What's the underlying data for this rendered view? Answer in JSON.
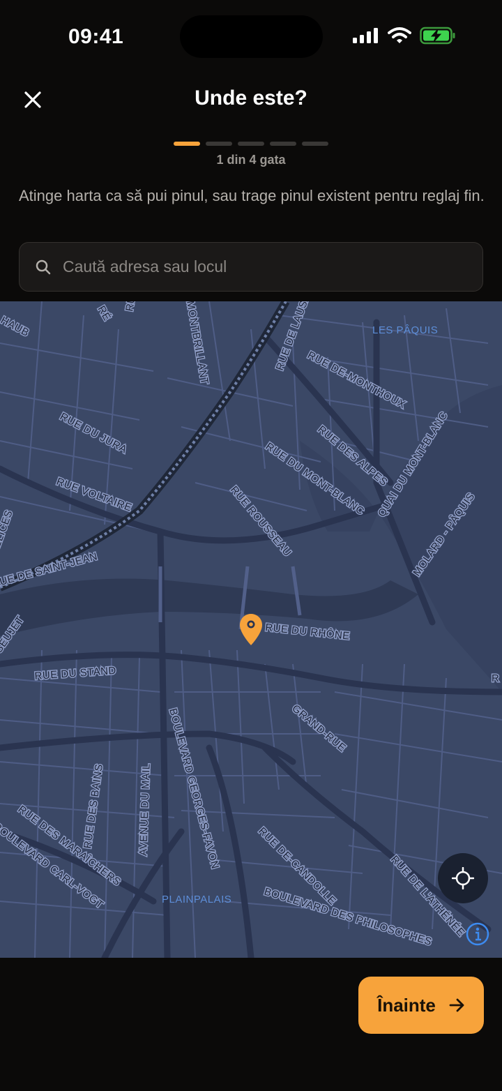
{
  "status_bar": {
    "time": "09:41"
  },
  "header": {
    "title": "Unde este?",
    "close_icon": "close-icon"
  },
  "progress": {
    "total_steps": 5,
    "completed_steps": 1,
    "label": "1 din 4 gata",
    "accent": "#f7a33b"
  },
  "instructions": "Atinge harta ca să pui pinul, sau trage pinul existent pentru reglaj fin.",
  "search": {
    "placeholder": "Caută adresa sau locul",
    "icon": "search-icon"
  },
  "map": {
    "districts": [
      "LES PÂQUIS",
      "PLAINPALAIS"
    ],
    "streets": [
      "HAUB",
      "RÉ",
      "RUE DU",
      "MONTBRILLANT",
      "RUE DE LAUSA",
      "RUE DE-MONTHOUX",
      "RUE DU JURA",
      "RUE DES ALPES",
      "QUAI DU MONT-BLANC",
      "RUE DU MONT-BLANC",
      "RUE VOLTAIRE",
      "DÉLICES",
      "RUE ROUSSEAU",
      "MOLARD - PÂQUIS",
      "RUE DE SAINT-JEAN",
      "RUE DU RHÔNE",
      "SEUJET",
      "RUE DU STAND",
      "GRAND-RUE",
      "BOULEVARD GEORGES-FAVON",
      "AVENUE DU MAIL",
      "RUE DES BAINS",
      "RUE DES MARAÎCHERS",
      "BOULEVARD CARL-VOGT",
      "RUE DE-CANDOLLE",
      "RUE DE L'ATHÉNÉE",
      "BOULEVARD DES PHILOSOPHES",
      "R"
    ],
    "pin_color": "#f7a33b"
  },
  "next_button": {
    "label": "Înainte",
    "icon": "arrow-right-icon"
  }
}
